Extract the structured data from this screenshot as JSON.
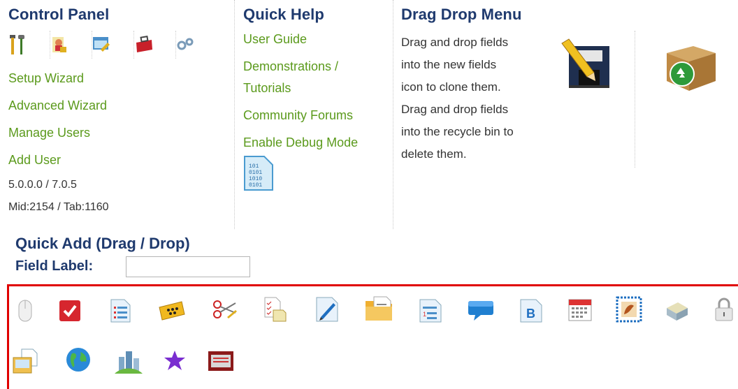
{
  "control_panel": {
    "title": "Control Panel",
    "icons": [
      "tools-icon",
      "user-lock-icon",
      "window-edit-icon",
      "toolbox-icon",
      "gears-icon"
    ],
    "links": [
      "Setup Wizard",
      "Advanced Wizard",
      "Manage Users",
      "Add User"
    ],
    "version": "5.0.0.0 / 7.0.5",
    "ids": "Mid:2154 / Tab:1160"
  },
  "quick_help": {
    "title": "Quick Help",
    "links": [
      "User Guide",
      "Demonstrations /",
      "Tutorials",
      "Community Forums",
      "Enable Debug Mode"
    ],
    "debug_icon": "binary-file-icon"
  },
  "drag_drop": {
    "title": "Drag Drop Menu",
    "text_lines": [
      "Drag and drop fields",
      "into the new fields",
      "icon to clone them.",
      "Drag and drop fields",
      "into the recycle bin to",
      "delete them."
    ],
    "clone_icon": "new-fields-icon",
    "recycle_icon": "recycle-bin-icon"
  },
  "quick_add": {
    "title": "Quick Add (Drag / Drop)",
    "field_label": "Field Label:",
    "field_value": ""
  },
  "palette": {
    "row1": [
      "mouse-icon",
      "checkbox-icon",
      "list-icon",
      "dots-icon",
      "scissors-icon",
      "checklist-doc-icon",
      "pen-icon",
      "folder-doc-icon",
      "numbered-doc-icon",
      "speech-bubble-icon",
      "bold-doc-icon",
      "calendar-icon",
      "stamp-image-icon",
      "drive-icon",
      "padlock-icon"
    ],
    "row2": [
      "window-doc-icon",
      "globe-icon",
      "city-icon",
      "star-icon",
      "film-icon"
    ]
  },
  "colors": {
    "link": "#5b9a1c",
    "heading": "#1f3a6e",
    "palette_border": "#e00000"
  }
}
